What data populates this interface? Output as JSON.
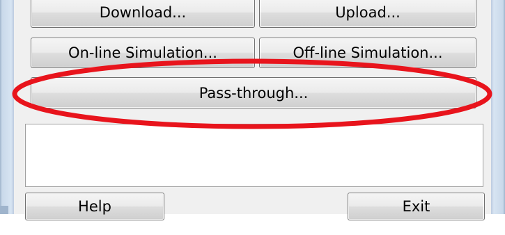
{
  "buttons": {
    "download": "Download...",
    "upload": "Upload...",
    "online_simulation": "On-line Simulation...",
    "offline_simulation": "Off-line Simulation...",
    "pass_through": "Pass-through...",
    "help": "Help",
    "exit": "Exit"
  },
  "status_box": {
    "text": ""
  },
  "annotation": {
    "color": "#e8141c",
    "shape": "ellipse",
    "target": "pass-through-button"
  }
}
